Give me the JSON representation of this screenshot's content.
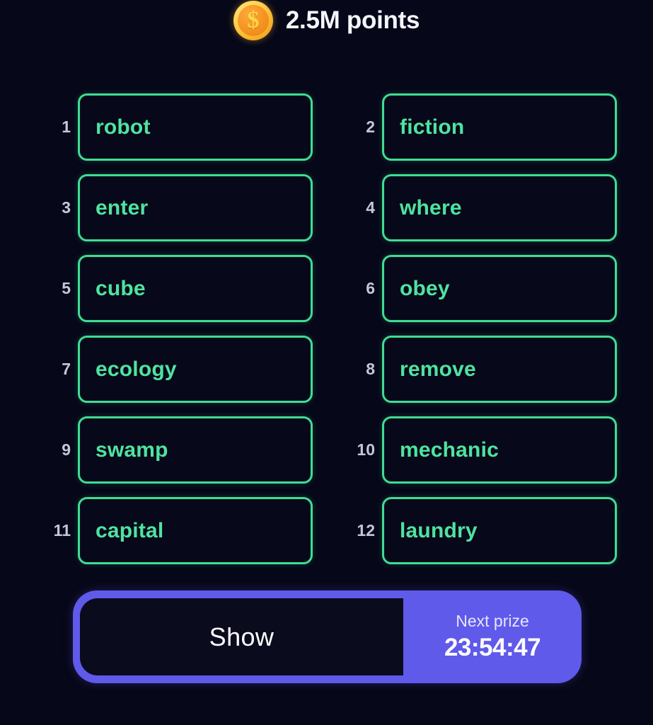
{
  "header": {
    "coin_icon": "coin-dollar-icon",
    "coin_glyph": "$",
    "points_label": "2.5M points"
  },
  "word_grid": {
    "columns": 2,
    "items": [
      {
        "index": "1",
        "word": "robot"
      },
      {
        "index": "2",
        "word": "fiction"
      },
      {
        "index": "3",
        "word": "enter"
      },
      {
        "index": "4",
        "word": "where"
      },
      {
        "index": "5",
        "word": "cube"
      },
      {
        "index": "6",
        "word": "obey"
      },
      {
        "index": "7",
        "word": "ecology"
      },
      {
        "index": "8",
        "word": "remove"
      },
      {
        "index": "9",
        "word": "swamp"
      },
      {
        "index": "10",
        "word": "mechanic"
      },
      {
        "index": "11",
        "word": "capital"
      },
      {
        "index": "12",
        "word": "laundry"
      }
    ]
  },
  "action_bar": {
    "show_label": "Show",
    "next_prize_caption": "Next prize",
    "next_prize_timer": "23:54:47"
  },
  "colors": {
    "background": "#060718",
    "tile_border": "#40DC93",
    "tile_text": "#4EE3A0",
    "index_text": "#C3C8D7",
    "accent_purple": "#5F5AEA",
    "show_panel": "#0A0B1C",
    "coin_orange": "#F59321",
    "coin_rim": "#FFD14F",
    "points_text": "#F4F6FB"
  }
}
